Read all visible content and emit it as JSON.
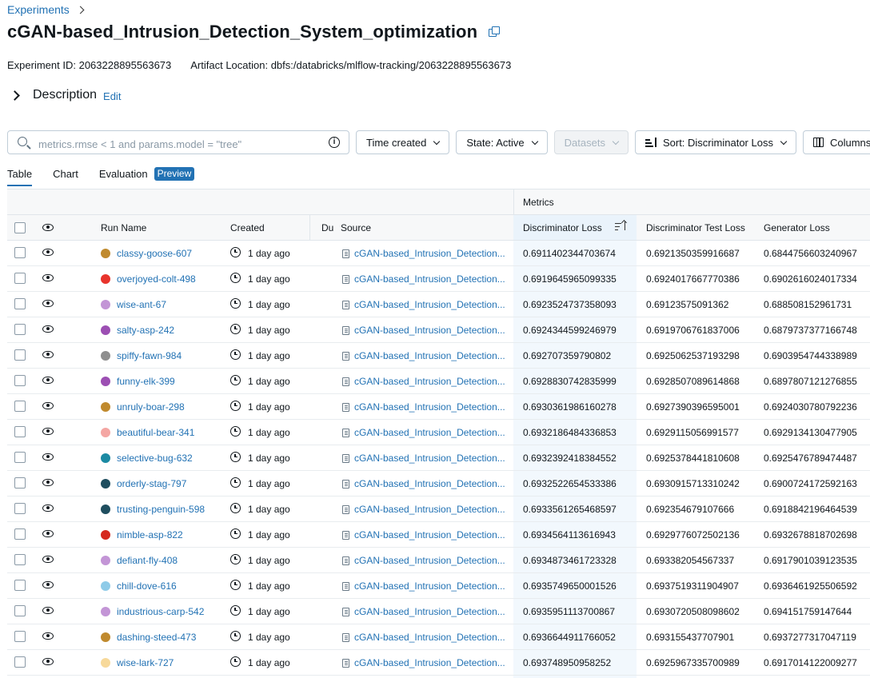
{
  "breadcrumb": {
    "label": "Experiments"
  },
  "experiment": {
    "title": "cGAN-based_Intrusion_Detection_System_optimization",
    "id_label": "Experiment ID: 2063228895563673",
    "artifact_label": "Artifact Location: dbfs:/databricks/mlflow-tracking/2063228895563673"
  },
  "description": {
    "label": "Description",
    "edit": "Edit"
  },
  "filters": {
    "search_placeholder": "metrics.rmse < 1 and params.model = \"tree\"",
    "time_created": "Time created",
    "state": "State: Active",
    "datasets": "Datasets",
    "sort": "Sort: Discriminator Loss",
    "columns": "Columns"
  },
  "tabs": [
    {
      "label": "Table"
    },
    {
      "label": "Chart"
    },
    {
      "label": "Evaluation"
    }
  ],
  "preview_badge": "Preview",
  "table": {
    "group_header": "Metrics",
    "headers": {
      "run_name": "Run Name",
      "created": "Created",
      "duration": "Du",
      "source": "Source",
      "m1": "Discriminator Loss",
      "m2": "Discriminator Test Loss",
      "m3": "Generator Loss"
    },
    "rows": [
      {
        "color": "#c08a2e",
        "name": "classy-goose-607",
        "created": "1 day ago",
        "source": "cGAN-based_Intrusion_Detection...",
        "m1": "0.6911402344703674",
        "m2": "0.6921350359916687",
        "m3": "0.6844756603240967"
      },
      {
        "color": "#e8342c",
        "name": "overjoyed-colt-498",
        "created": "1 day ago",
        "source": "cGAN-based_Intrusion_Detection...",
        "m1": "0.6919645965099335",
        "m2": "0.6924017667770386",
        "m3": "0.6902616024017334"
      },
      {
        "color": "#c395d6",
        "name": "wise-ant-67",
        "created": "1 day ago",
        "source": "cGAN-based_Intrusion_Detection...",
        "m1": "0.6923524737358093",
        "m2": "0.69123575091362",
        "m3": "0.688508152961731"
      },
      {
        "color": "#9c4fb3",
        "name": "salty-asp-242",
        "created": "1 day ago",
        "source": "cGAN-based_Intrusion_Detection...",
        "m1": "0.6924344599246979",
        "m2": "0.6919706761837006",
        "m3": "0.6879737377166748"
      },
      {
        "color": "#8e8e8e",
        "name": "spiffy-fawn-984",
        "created": "1 day ago",
        "source": "cGAN-based_Intrusion_Detection...",
        "m1": "0.692707359790802",
        "m2": "0.6925062537193298",
        "m3": "0.6903954744338989"
      },
      {
        "color": "#9c4fb3",
        "name": "funny-elk-399",
        "created": "1 day ago",
        "source": "cGAN-based_Intrusion_Detection...",
        "m1": "0.6928830742835999",
        "m2": "0.6928507089614868",
        "m3": "0.6897807121276855"
      },
      {
        "color": "#c08a2e",
        "name": "unruly-boar-298",
        "created": "1 day ago",
        "source": "cGAN-based_Intrusion_Detection...",
        "m1": "0.6930361986160278",
        "m2": "0.6927390396595001",
        "m3": "0.6924030780792236"
      },
      {
        "color": "#f4a6a3",
        "name": "beautiful-bear-341",
        "created": "1 day ago",
        "source": "cGAN-based_Intrusion_Detection...",
        "m1": "0.6932186484336853",
        "m2": "0.6929115056991577",
        "m3": "0.6929134130477905"
      },
      {
        "color": "#1c8aa3",
        "name": "selective-bug-632",
        "created": "1 day ago",
        "source": "cGAN-based_Intrusion_Detection...",
        "m1": "0.6932392418384552",
        "m2": "0.6925378441810608",
        "m3": "0.6925476789474487"
      },
      {
        "color": "#1f4e5f",
        "name": "orderly-stag-797",
        "created": "1 day ago",
        "source": "cGAN-based_Intrusion_Detection...",
        "m1": "0.6932522654533386",
        "m2": "0.6930915713310242",
        "m3": "0.6900724172592163"
      },
      {
        "color": "#1f4e5f",
        "name": "trusting-penguin-598",
        "created": "1 day ago",
        "source": "cGAN-based_Intrusion_Detection...",
        "m1": "0.6933561265468597",
        "m2": "0.692354679107666",
        "m3": "0.6918842196464539"
      },
      {
        "color": "#d5281e",
        "name": "nimble-asp-822",
        "created": "1 day ago",
        "source": "cGAN-based_Intrusion_Detection...",
        "m1": "0.6934564113616943",
        "m2": "0.6929776072502136",
        "m3": "0.6932678818702698"
      },
      {
        "color": "#c395d6",
        "name": "defiant-fly-408",
        "created": "1 day ago",
        "source": "cGAN-based_Intrusion_Detection...",
        "m1": "0.6934873461723328",
        "m2": "0.693382054567337",
        "m3": "0.6917901039123535"
      },
      {
        "color": "#8fcbe8",
        "name": "chill-dove-616",
        "created": "1 day ago",
        "source": "cGAN-based_Intrusion_Detection...",
        "m1": "0.6935749650001526",
        "m2": "0.6937519311904907",
        "m3": "0.6936461925506592"
      },
      {
        "color": "#c395d6",
        "name": "industrious-carp-542",
        "created": "1 day ago",
        "source": "cGAN-based_Intrusion_Detection...",
        "m1": "0.6935951113700867",
        "m2": "0.6930720508098602",
        "m3": "0.694151759147644"
      },
      {
        "color": "#c08a2e",
        "name": "dashing-steed-473",
        "created": "1 day ago",
        "source": "cGAN-based_Intrusion_Detection...",
        "m1": "0.6936644911766052",
        "m2": "0.693155437707901",
        "m3": "0.6937277317047119"
      },
      {
        "color": "#f7d99a",
        "name": "wise-lark-727",
        "created": "1 day ago",
        "source": "cGAN-based_Intrusion_Detection...",
        "m1": "0.693748950958252",
        "m2": "0.6925967335700989",
        "m3": "0.6917014122009277"
      }
    ]
  }
}
